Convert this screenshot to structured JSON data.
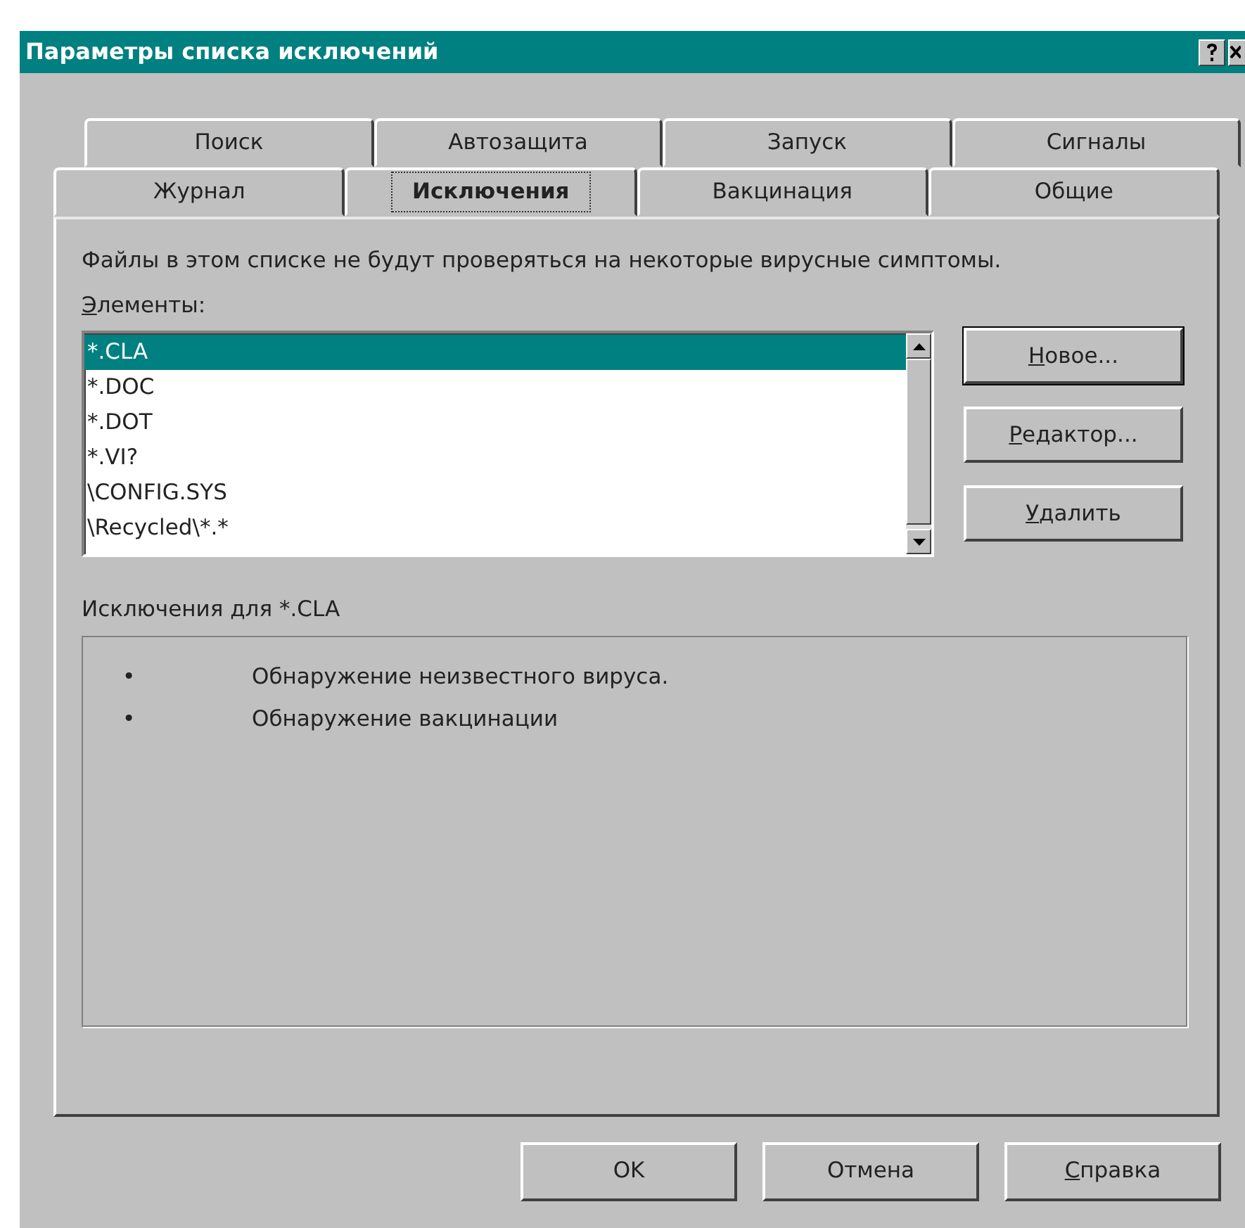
{
  "window": {
    "title": "Параметры списка исключений"
  },
  "tab_rows": [
    [
      {
        "label": "Поиск",
        "selected": false
      },
      {
        "label": "Автозащита",
        "selected": false
      },
      {
        "label": "Запуск",
        "selected": false
      },
      {
        "label": "Сигналы",
        "selected": false
      }
    ],
    [
      {
        "label": "Журнал",
        "selected": false
      },
      {
        "label": "Исключения",
        "selected": true
      },
      {
        "label": "Вакцинация",
        "selected": false
      },
      {
        "label": "Общие",
        "selected": false
      }
    ]
  ],
  "description": "Файлы в этом списке не будут проверяться на некоторые вирусные симптомы.",
  "items_label": {
    "text": "Элементы:",
    "underline_first": true
  },
  "items": [
    {
      "text": "*.CLA",
      "selected": true
    },
    {
      "text": "*.DOC",
      "selected": false
    },
    {
      "text": "*.DOT",
      "selected": false
    },
    {
      "text": "*.VI?",
      "selected": false
    },
    {
      "text": "\\CONFIG.SYS",
      "selected": false
    },
    {
      "text": "\\Recycled\\*.*",
      "selected": false
    }
  ],
  "side_buttons": [
    {
      "label": "Новое...",
      "underline_first": true,
      "default": true
    },
    {
      "label": "Редактор...",
      "underline_first": true,
      "default": false
    },
    {
      "label": "Удалить",
      "underline_first": true,
      "default": false
    }
  ],
  "exceptions": {
    "title": "Исключения для *.CLA",
    "entries": [
      {
        "bullet": "•",
        "text": "Обнаружение неизвестного вируса."
      },
      {
        "bullet": "•",
        "text": "Обнаружение вакцинации"
      }
    ]
  },
  "footer_buttons": [
    {
      "label": "OK",
      "underline_first": false
    },
    {
      "label": "Отмена",
      "underline_first": false
    },
    {
      "label": "Справка",
      "underline_first": true
    }
  ]
}
